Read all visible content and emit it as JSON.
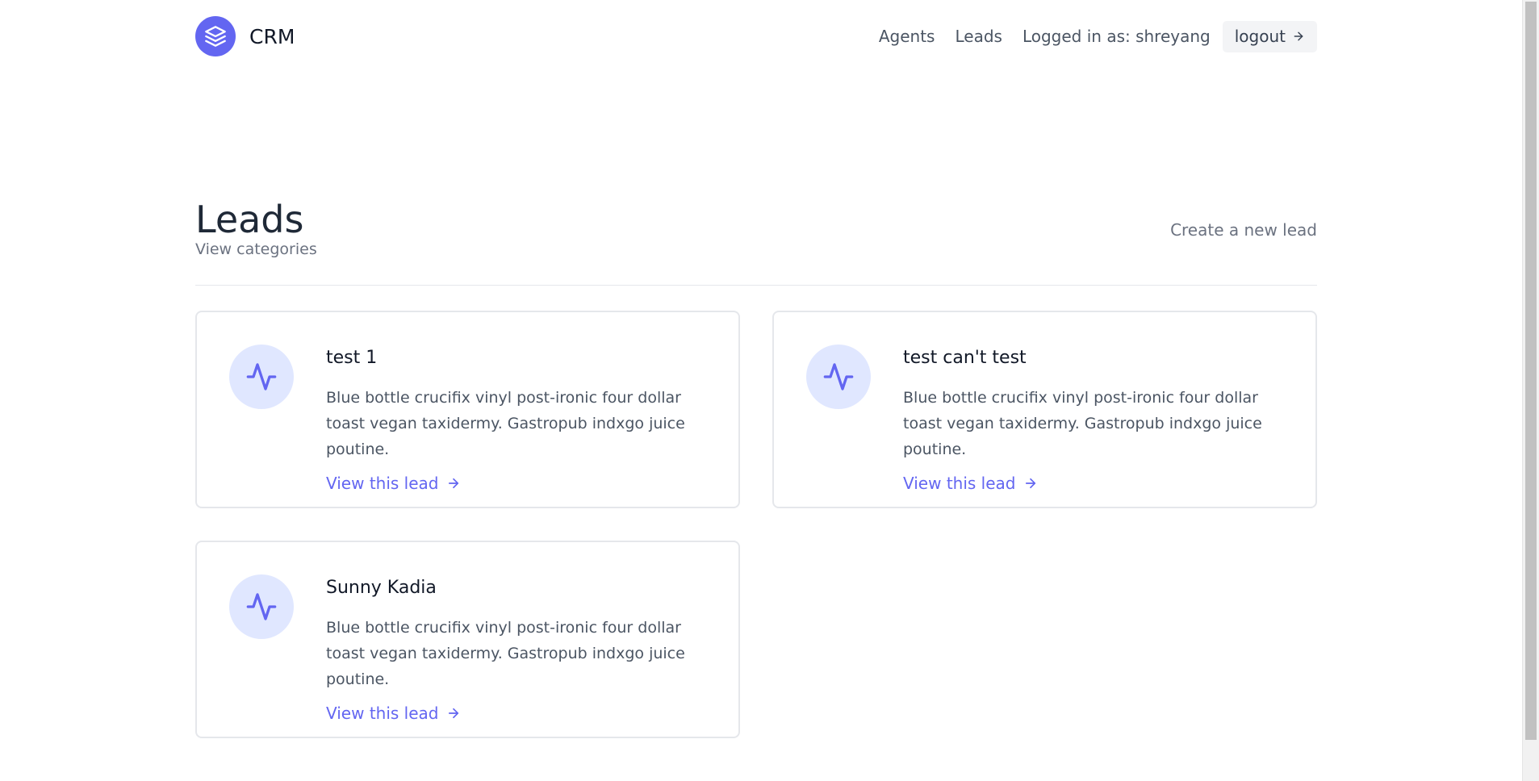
{
  "header": {
    "brand": "CRM",
    "nav": {
      "agents": "Agents",
      "leads": "Leads",
      "logged_in": "Logged in as: shreyang",
      "logout": "logout"
    }
  },
  "main": {
    "title": "Leads",
    "subtitle_link": "View categories",
    "create_link": "Create a new lead",
    "leads": [
      {
        "name": "test 1",
        "description": "Blue bottle crucifix vinyl post-ironic four dollar toast vegan taxidermy. Gastropub indxgo juice poutine.",
        "link": "View this lead"
      },
      {
        "name": "test can't test",
        "description": "Blue bottle crucifix vinyl post-ironic four dollar toast vegan taxidermy. Gastropub indxgo juice poutine.",
        "link": "View this lead"
      },
      {
        "name": "Sunny Kadia",
        "description": "Blue bottle crucifix vinyl post-ironic four dollar toast vegan taxidermy. Gastropub indxgo juice poutine.",
        "link": "View this lead"
      }
    ]
  },
  "icons": {
    "logo": "layers-icon",
    "card": "activity-icon",
    "arrow": "arrow-right-icon"
  },
  "colors": {
    "accent": "#6366f1",
    "icon_bg": "#e0e7ff",
    "muted_text": "#6b7280",
    "border": "#e5e7eb"
  }
}
